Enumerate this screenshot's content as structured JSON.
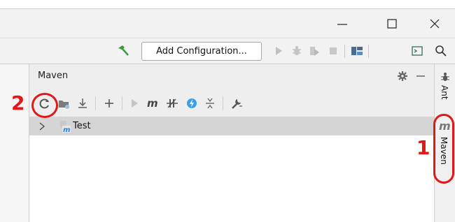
{
  "titlebar": {
    "minimize_glyph": "–",
    "maximize_glyph": "☐",
    "close_glyph": "✕"
  },
  "toolbar": {
    "configuration_label": "Add Configuration...",
    "icons": [
      "build-hammer-icon",
      "run-icon",
      "debug-icon",
      "run-with-coverage-icon",
      "stop-icon",
      "project-structure-icon",
      "terminal-icon",
      "search-icon"
    ]
  },
  "panel": {
    "title": "Maven",
    "toolbar_icons": [
      "reload-icon",
      "generate-sources-icon",
      "download-icon",
      "add-icon",
      "run-icon",
      "execute-goal-icon",
      "toggle-offline-icon",
      "skip-tests-icon",
      "collapse-all-icon",
      "settings-wrench-icon"
    ]
  },
  "tree": {
    "items": [
      {
        "label": "Test",
        "icon": "maven-project-icon",
        "expanded": false
      }
    ]
  },
  "right_sidebar": {
    "tabs": [
      {
        "label": "Ant",
        "icon": "ant-icon"
      },
      {
        "label": "Maven",
        "icon": "maven-icon"
      }
    ]
  },
  "annotations": {
    "step1": "1",
    "step2": "2",
    "color": "#e01818"
  },
  "colors": {
    "accent_green": "#3c9a3c",
    "selection_gray": "#d5d5d5",
    "annotation_red": "#e01818"
  }
}
